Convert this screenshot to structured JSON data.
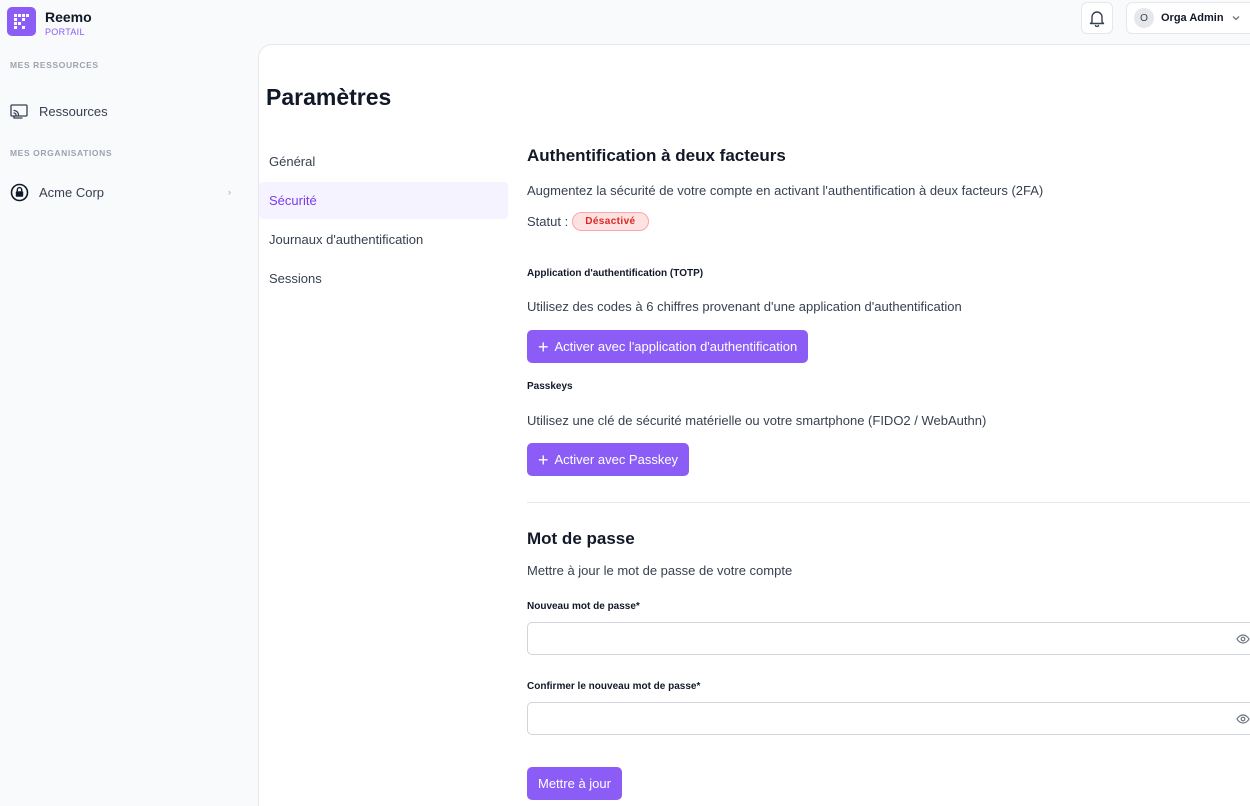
{
  "brand": {
    "name": "Reemo",
    "sub": "PORTAIL"
  },
  "header": {
    "user_initial": "O",
    "user_name": "Orga Admin"
  },
  "sidebar": {
    "section1": "MES RESSOURCES",
    "resources_label": "Ressources",
    "section2": "MES ORGANISATIONS",
    "org_label": "Acme Corp"
  },
  "page": {
    "title": "Paramètres"
  },
  "subnav": [
    {
      "label": "Général"
    },
    {
      "label": "Sécurité"
    },
    {
      "label": "Journaux d'authentification"
    },
    {
      "label": "Sessions"
    }
  ],
  "twofa": {
    "title": "Authentification à deux facteurs",
    "description": "Augmentez la sécurité de votre compte en activant l'authentification à deux facteurs (2FA)",
    "status_label": "Statut :",
    "status_value": "Désactivé",
    "totp_title": "Application d'authentification (TOTP)",
    "totp_description": "Utilisez des codes à 6 chiffres provenant d'une application d'authentification",
    "totp_button": "Activer avec l'application d'authentification",
    "passkey_title": "Passkeys",
    "passkey_description": "Utilisez une clé de sécurité matérielle ou votre smartphone (FIDO2 / WebAuthn)",
    "passkey_button": "Activer avec Passkey"
  },
  "password": {
    "title": "Mot de passe",
    "description": "Mettre à jour le mot de passe de votre compte",
    "new_label": "Nouveau mot de passe*",
    "new_value": "",
    "confirm_label": "Confirmer le nouveau mot de passe*",
    "confirm_value": "",
    "submit": "Mettre à jour"
  },
  "colors": {
    "accent": "#8b5cf6",
    "danger": "#dc2626"
  }
}
